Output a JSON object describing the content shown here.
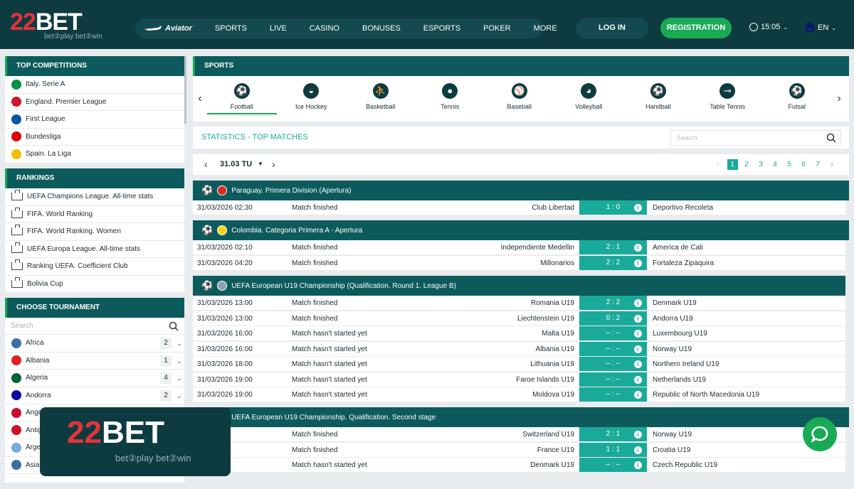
{
  "header": {
    "logo": {
      "text_num": "22",
      "text_bet": "BET",
      "tagline": "bet②play bet②win"
    },
    "nav": [
      "SPORTS",
      "LIVE",
      "CASINO",
      "BONUSES",
      "ESPORTS",
      "POKER",
      "MORE"
    ],
    "aviator": "Aviator",
    "login": "LOG IN",
    "register": "REGISTRATION",
    "time": "15:05",
    "lang": "EN"
  },
  "top_competitions": {
    "title": "TOP COMPETITIONS",
    "items": [
      {
        "label": "Italy. Serie A",
        "flag": "#009246"
      },
      {
        "label": "England. Premier League",
        "flag": "#cf142b"
      },
      {
        "label": "First League",
        "flag": "#0055a4"
      },
      {
        "label": "Bundesliga",
        "flag": "#dd0000"
      },
      {
        "label": "Spain. La Liga",
        "flag": "#f1bf00"
      }
    ]
  },
  "rankings": {
    "title": "RANKINGS",
    "items": [
      "UEFA Champions League. All-time stats",
      "FIFA. World Ranking",
      "FIFA. World Ranking. Women",
      "UEFA Europa League. All-time stats",
      "Ranking UEFA. Coefficient Club",
      "Bolivia Cup"
    ]
  },
  "tournaments": {
    "title": "CHOOSE TOURNAMENT",
    "search_placeholder": "Search",
    "items": [
      {
        "label": "Africa",
        "count": "2",
        "flag": "#3a6ea5"
      },
      {
        "label": "Albania",
        "count": "1",
        "flag": "#e41e20"
      },
      {
        "label": "Algeria",
        "count": "4",
        "flag": "#006233"
      },
      {
        "label": "Andorra",
        "count": "2",
        "flag": "#10069f"
      },
      {
        "label": "Ango",
        "count": "",
        "flag": "#cc092f"
      },
      {
        "label": "Antig",
        "count": "",
        "flag": "#ce1126"
      },
      {
        "label": "Argen",
        "count": "",
        "flag": "#74acdf"
      },
      {
        "label": "Asia",
        "count": "",
        "flag": "#3a6ea5"
      }
    ]
  },
  "sports": {
    "title": "SPORTS",
    "items": [
      "Football",
      "Ice Hockey",
      "Basketball",
      "Tennis",
      "Baseball",
      "Volleyball",
      "Handball",
      "Table Tennis",
      "Futsal"
    ]
  },
  "stats": {
    "title": "STATISTICS - TOP MATCHES",
    "search_placeholder": "Search"
  },
  "date": "31.03 TU",
  "pages": [
    "1",
    "2",
    "3",
    "4",
    "5",
    "6",
    "7"
  ],
  "groups": [
    {
      "title": "Paraguay. Primera Division (Apertura)",
      "flag": "#d52b1e",
      "matches": [
        {
          "date": "31/03/2026 02:30",
          "status": "Match finished",
          "home": "Club Libertad",
          "score": "1 : 0",
          "away": "Deportivo Recoleta"
        }
      ]
    },
    {
      "title": "Colombia. Categoria Primera A - Apertura",
      "flag": "#fcd116",
      "matches": [
        {
          "date": "31/03/2026 02:10",
          "status": "Match finished",
          "home": "Independiente Medellin",
          "score": "2 : 1",
          "away": "America de Cali"
        },
        {
          "date": "31/03/2026 04:20",
          "status": "Match finished",
          "home": "Millonarios",
          "score": "2 : 2",
          "away": "Fortaleza Zipaquira"
        }
      ]
    },
    {
      "title": "UEFA European U19 Championship (Qualification. Round 1. League B)",
      "flag": "#8aa3b0",
      "matches": [
        {
          "date": "31/03/2026 13:00",
          "status": "Match finished",
          "home": "Romania U19",
          "score": "2 : 2",
          "away": "Denmark U19"
        },
        {
          "date": "31/03/2026 13:00",
          "status": "Match finished",
          "home": "Liechtenstein U19",
          "score": "0 : 2",
          "away": "Andorra U19"
        },
        {
          "date": "31/03/2026 16:00",
          "status": "Match hasn't started yet",
          "home": "Malta U19",
          "score": "– : –",
          "away": "Luxembourg U19"
        },
        {
          "date": "31/03/2026 16:00",
          "status": "Match hasn't started yet",
          "home": "Albania U19",
          "score": "– : –",
          "away": "Norway U19"
        },
        {
          "date": "31/03/2026 18:00",
          "status": "Match hasn't started yet",
          "home": "Lithuania U19",
          "score": "– : –",
          "away": "Northern Ireland U19"
        },
        {
          "date": "31/03/2026 19:00",
          "status": "Match hasn't started yet",
          "home": "Faroe Islands U19",
          "score": "– : –",
          "away": "Netherlands U19"
        },
        {
          "date": "31/03/2026 19:00",
          "status": "Match hasn't started yet",
          "home": "Moldova U19",
          "score": "– : –",
          "away": "Republic of North Macedonia U19"
        }
      ]
    },
    {
      "title": "UEFA European U19 Championship. Qualification. Second stage",
      "flag": "#8aa3b0",
      "matches": [
        {
          "date": "6 13:00",
          "status": "Match finished",
          "home": "Switzerland U19",
          "score": "2 : 1",
          "away": "Norway U19"
        },
        {
          "date": "6 13:00",
          "status": "Match finished",
          "home": "France U19",
          "score": "1 : 1",
          "away": "Croatia U19"
        },
        {
          "date": "6 15:00",
          "status": "Match hasn't started yet",
          "home": "Denmark U19",
          "score": "– : –",
          "away": "Czech Republic U19"
        }
      ]
    }
  ],
  "overlay": {
    "num": "22",
    "bet": "BET",
    "tagline": "bet②play  bet②win"
  }
}
